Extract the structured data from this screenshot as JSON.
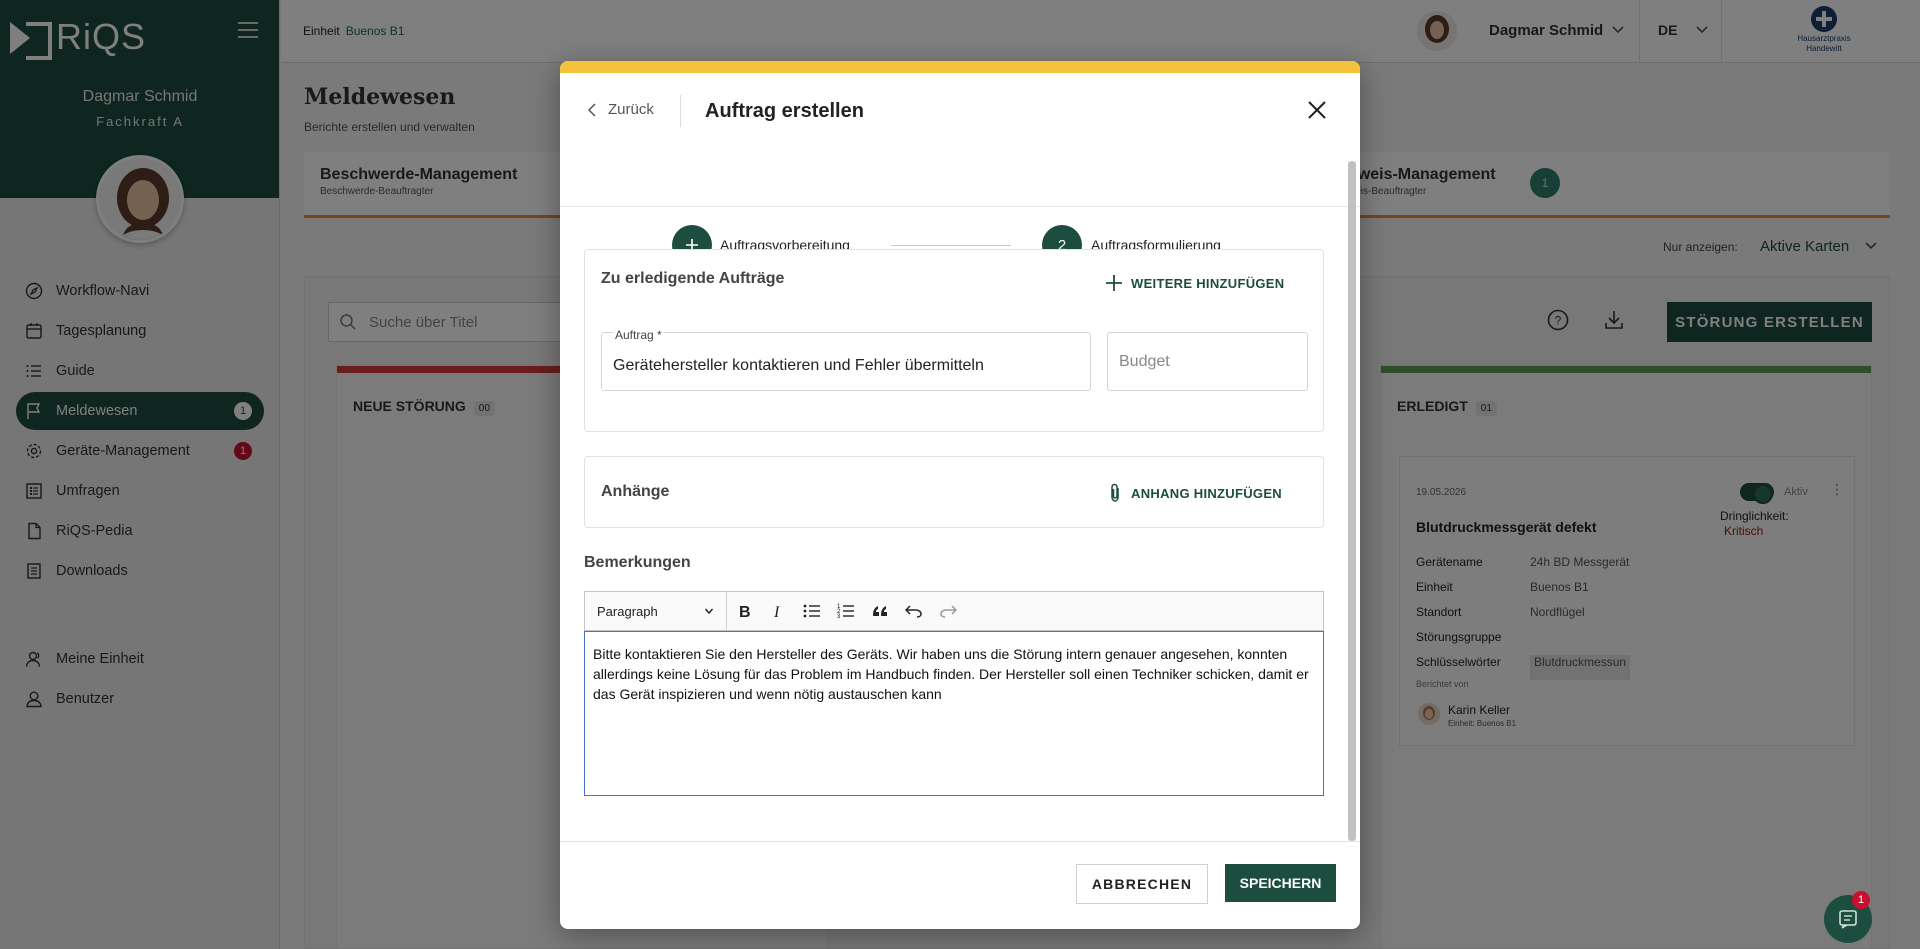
{
  "sidebar": {
    "logo_text": "RiQS",
    "user_name": "Dagmar Schmid",
    "user_role": "Fachkraft A",
    "items": [
      {
        "label": "Workflow-Navi",
        "icon": "compass-icon"
      },
      {
        "label": "Tagesplanung",
        "icon": "calendar-icon"
      },
      {
        "label": "Guide",
        "icon": "list-icon"
      },
      {
        "label": "Meldewesen",
        "icon": "flag-icon",
        "badge": "1",
        "active": true
      },
      {
        "label": "Geräte-Management",
        "icon": "gear-icon",
        "badge": "1"
      },
      {
        "label": "Umfragen",
        "icon": "survey-icon"
      },
      {
        "label": "RiQS-Pedia",
        "icon": "document-icon"
      },
      {
        "label": "Downloads",
        "icon": "downloads-icon"
      }
    ],
    "bottom_items": [
      {
        "label": "Meine Einheit",
        "icon": "group-icon"
      },
      {
        "label": "Benutzer",
        "icon": "user-icon"
      }
    ]
  },
  "header": {
    "unit_label": "Einheit",
    "unit_value": "Buenos B1",
    "user_name": "Dagmar Schmid",
    "language": "DE",
    "org_line1": "Hausarztpraxis",
    "org_line2": "Handewitt"
  },
  "page": {
    "title": "Meldewesen",
    "subtitle": "Berichte erstellen und verwalten",
    "tabs": [
      {
        "title": "Beschwerde-Management",
        "sub": "Beschwerde-Beauftragter"
      },
      {
        "title": "nweis-Management",
        "sub": "weis-Beauftragter",
        "badge": "1"
      }
    ],
    "filter_label": "Nur anzeigen:",
    "filter_value": "Aktive Karten",
    "search_placeholder": "Suche über Titel",
    "create_button": "STÖRUNG ERSTELLEN",
    "columns": [
      {
        "title": "NEUE STÖRUNG",
        "count": "00",
        "color": "#d63b3b"
      },
      {
        "title": "ERLEDIGT",
        "count": "01",
        "color": "#5aa050"
      }
    ],
    "card": {
      "date": "19.05.2026",
      "status": "Aktiv",
      "urgency_label": "Dringlichkeit:",
      "urgency_value": "Kritisch",
      "title": "Blutdruckmessgerät defekt",
      "rows": [
        {
          "k": "Gerätename",
          "v": "24h BD Messgerät"
        },
        {
          "k": "Einheit",
          "v": "Buenos B1"
        },
        {
          "k": "Standort",
          "v": "Nordflügel"
        },
        {
          "k": "Störungsgruppe",
          "v": ""
        },
        {
          "k": "Schlüsselwörter",
          "v": "Blutdruckmessun"
        }
      ],
      "reported_by_label": "Berichtet von",
      "reporter": "Karin Keller",
      "reporter_unit": "Einheit: Buenos B1"
    },
    "chat_badge": "1"
  },
  "modal": {
    "back_label": "Zurück",
    "title": "Auftrag erstellen",
    "steps": [
      {
        "number": "+",
        "label": "Auftragsvorbereitung"
      },
      {
        "number": "2",
        "label": "Auftragsformulierung"
      }
    ],
    "orders_section": {
      "title": "Zu erledigende Aufträge",
      "add_label": "WEITERE HINZUFÜGEN",
      "field_label": "Auftrag",
      "required_mark": "*",
      "field_value": "Gerätehersteller kontaktieren und Fehler übermitteln",
      "budget_placeholder": "Budget"
    },
    "attachments_section": {
      "title": "Anhänge",
      "add_label": "ANHANG HINZUFÜGEN"
    },
    "remarks_title": "Bemerkungen",
    "editor": {
      "paragraph_select": "Paragraph",
      "text": "Bitte kontaktieren Sie den Hersteller des Geräts. Wir haben uns die Störung intern genauer angesehen, konnten allerdings keine Lösung für das Problem im Handbuch finden. Der Hersteller soll einen Techniker schicken, damit er das Gerät inspizieren und wenn nötig austauschen kann"
    },
    "cancel_label": "ABBRECHEN",
    "save_label": "SPEICHERN"
  },
  "colors": {
    "brand": "#1c4d3f",
    "modal_accent": "#f4c33b",
    "danger": "#c8102e"
  }
}
